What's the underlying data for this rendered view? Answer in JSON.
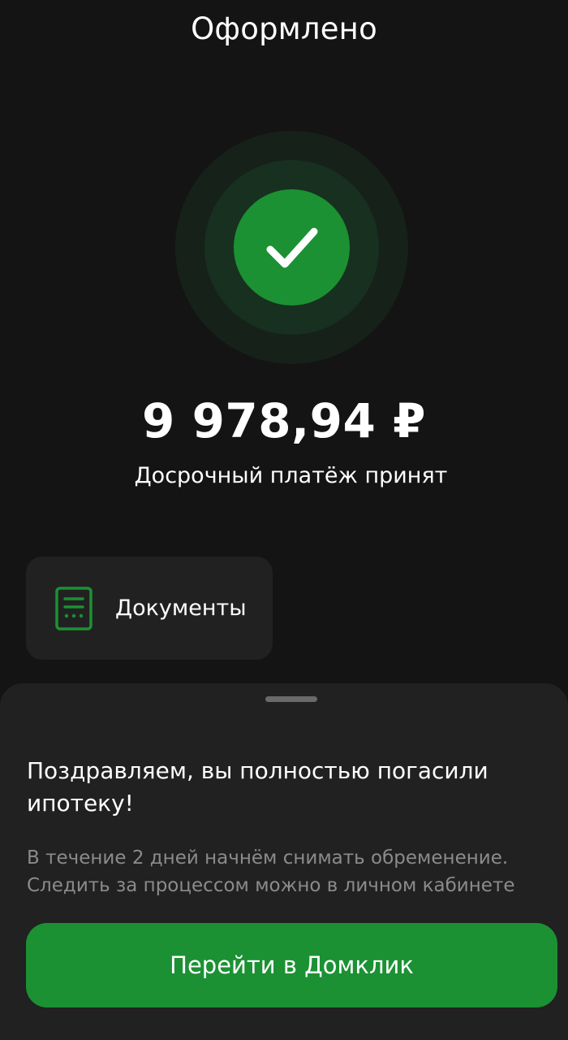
{
  "header": {
    "title": "Оформлено"
  },
  "status": {
    "icon": "checkmark-icon",
    "accent_color": "#1b9133"
  },
  "payment": {
    "amount": "9 978,94 ₽",
    "subtitle": "Досрочный платёж принят"
  },
  "documents": {
    "label": "Документы",
    "icon": "document-icon"
  },
  "sheet": {
    "title": "Поздравляем, вы полностью погасили ипотеку!",
    "description_line1": "В течение 2 дней начнём снимать обременение.",
    "description_line2": "Следить за процессом можно в личном кабинете",
    "button_label": "Перейти в Домклик"
  }
}
